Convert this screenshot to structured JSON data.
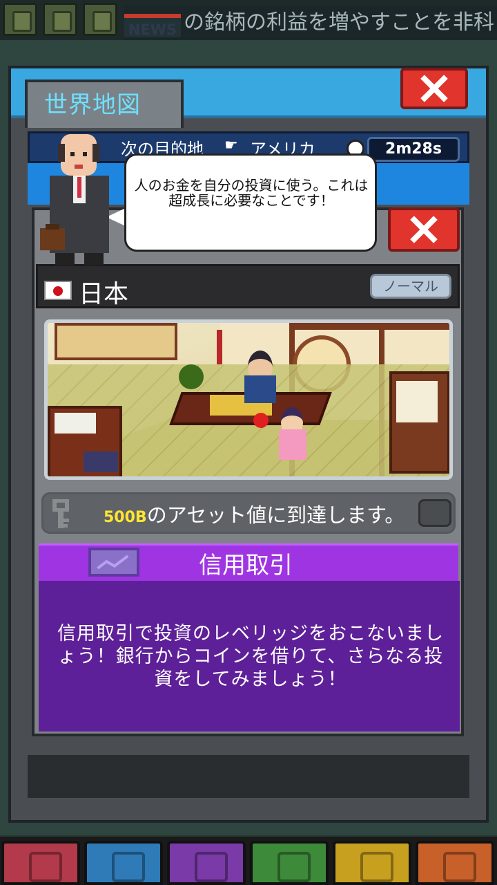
{
  "hud": {
    "buttons": [
      {
        "name": "trophy-icon",
        "color": "#4a5a3a"
      },
      {
        "name": "gear-icon",
        "color": "#4a5a3a"
      },
      {
        "name": "gift-icon",
        "color": "#4a5a3a"
      }
    ],
    "news_label": "NEWS",
    "ticker_text": "の銘柄の利益を増やすことを非科"
  },
  "back_window": {
    "title": "世界地図",
    "destination_label": "次の目的地",
    "destination_country": "アメリカ",
    "timer": "2m28s"
  },
  "speech": {
    "text": "人のお金を自分の投資に使う。これは超成長に必要なことです！"
  },
  "country": {
    "name": "日本",
    "flag": "japan-flag-icon",
    "difficulty": "ノーマル"
  },
  "mission": {
    "amount": "500B",
    "text": "のアセット値に到達します。"
  },
  "card": {
    "title": "信用取引",
    "description": "信用取引で投資のレベリッジをおこないましょう！銀行からコインを借りて、さらなる投資をしてみましょう！"
  },
  "bottom_nav": [
    {
      "name": "nav-ideas",
      "icon": "lightbulb-icon",
      "color": "#b23a4a"
    },
    {
      "name": "nav-staff",
      "icon": "people-icon",
      "color": "#2e7bb8"
    },
    {
      "name": "nav-invest",
      "icon": "chart-icon",
      "color": "#7a3aa8"
    },
    {
      "name": "nav-office",
      "icon": "chair-icon",
      "color": "#3d8a3a"
    },
    {
      "name": "nav-events",
      "icon": "calendar-icon",
      "color": "#c8a020"
    },
    {
      "name": "nav-shop",
      "icon": "cart-icon",
      "color": "#c8602a"
    }
  ]
}
